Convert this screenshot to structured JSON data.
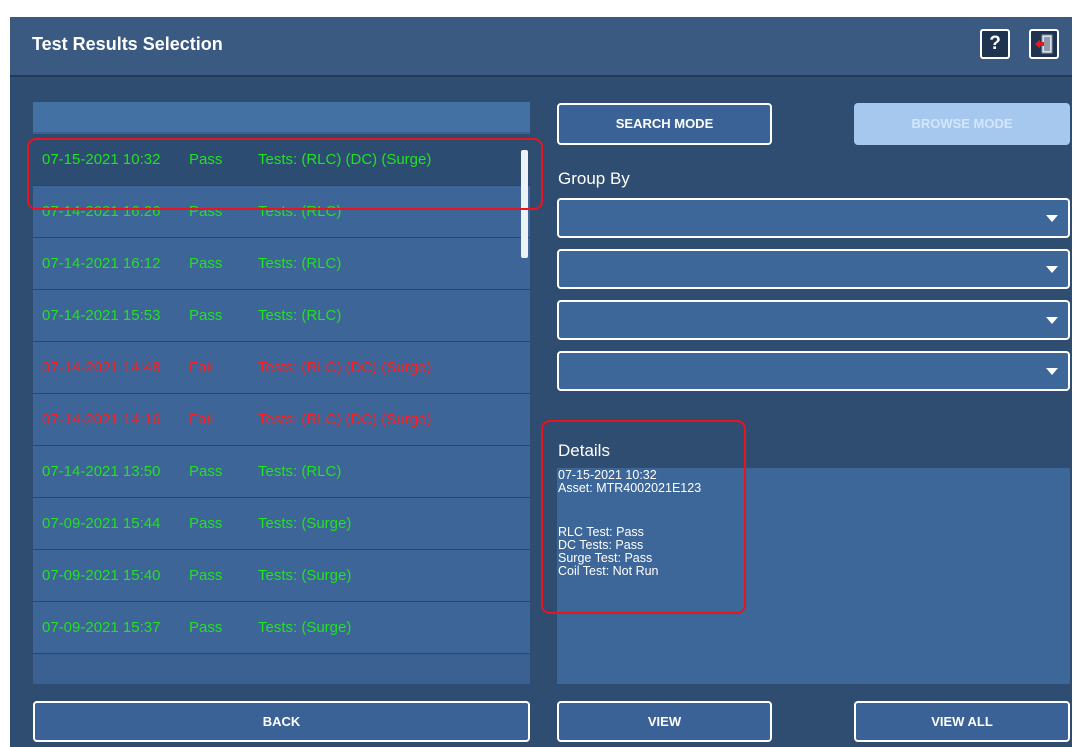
{
  "titlebar": {
    "title": "Test Results Selection",
    "help_label": "?",
    "help_icon": "question-mark-icon",
    "exit_icon": "exit-door-icon"
  },
  "results": [
    {
      "date": "07-15-2021 10:32",
      "status": "Pass",
      "tests": "Tests: (RLC) (DC) (Surge)",
      "selected": true
    },
    {
      "date": "07-14-2021 16:26",
      "status": "Pass",
      "tests": "Tests: (RLC)"
    },
    {
      "date": "07-14-2021 16:12",
      "status": "Pass",
      "tests": "Tests: (RLC)"
    },
    {
      "date": "07-14-2021 15:53",
      "status": "Pass",
      "tests": "Tests: (RLC)"
    },
    {
      "date": "07-14-2021 14:48",
      "status": "Fail",
      "tests": "Tests: (RLC) (DC) (Surge)"
    },
    {
      "date": "07-14-2021 14:16",
      "status": "Fail",
      "tests": "Tests: (RLC) (DC) (Surge)"
    },
    {
      "date": "07-14-2021 13:50",
      "status": "Pass",
      "tests": "Tests: (RLC)"
    },
    {
      "date": "07-09-2021 15:44",
      "status": "Pass",
      "tests": "Tests: (Surge)"
    },
    {
      "date": "07-09-2021 15:40",
      "status": "Pass",
      "tests": "Tests: (Surge)"
    },
    {
      "date": "07-09-2021 15:37",
      "status": "Pass",
      "tests": "Tests: (Surge)"
    }
  ],
  "modes": {
    "search_label": "SEARCH MODE",
    "browse_label": "BROWSE MODE"
  },
  "group_by": {
    "label": "Group By",
    "dropdowns": [
      "",
      "",
      "",
      ""
    ]
  },
  "details": {
    "label": "Details",
    "lines": [
      "07-15-2021 10:32",
      "Asset: MTR4002021E123",
      "",
      "RLC Test: Pass",
      "DC Tests: Pass",
      "Surge Test: Pass",
      "Coil Test: Not Run"
    ]
  },
  "footer": {
    "back_label": "BACK",
    "view_label": "VIEW",
    "view_all_label": "VIEW ALL"
  },
  "colors": {
    "pass": "#22e022",
    "fail": "#ff1f1f",
    "highlight": "#e8141e"
  }
}
